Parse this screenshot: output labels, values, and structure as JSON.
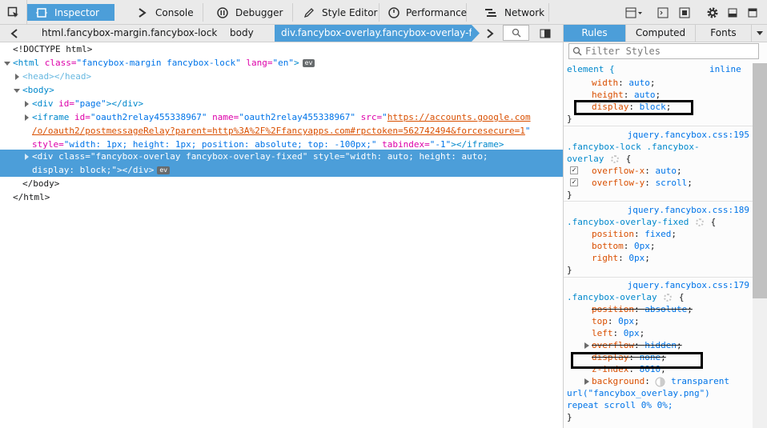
{
  "toolbar": {
    "tabs": [
      {
        "label": "Inspector",
        "icon": "inspector-icon"
      },
      {
        "label": "Console",
        "icon": "console-icon"
      },
      {
        "label": "Debugger",
        "icon": "debugger-icon"
      },
      {
        "label": "Style Editor",
        "icon": "style-editor-icon"
      },
      {
        "label": "Performance",
        "icon": "performance-icon"
      },
      {
        "label": "Network",
        "icon": "network-icon"
      }
    ]
  },
  "breadcrumb": [
    "html.fancybox-margin.fancybox-lock",
    "body",
    "div.fancybox-overlay.fancybox-overlay-fi..."
  ],
  "markup": {
    "doctype": "<!DOCTYPE html>",
    "html_open": {
      "tag": "<html",
      "a1": " class=",
      "v1": "\"fancybox-margin fancybox-lock\"",
      "a2": " lang=",
      "v2": "\"en\"",
      "end": ">"
    },
    "ev": "ev",
    "head": "<head></head>",
    "body_open": "<body>",
    "div_page": {
      "tag": "<div",
      "a1": " id=",
      "v1": "\"page\"",
      "end": "></div>"
    },
    "iframe": {
      "tag": "<iframe",
      "a1": " id=",
      "v1": "\"oauth2relay455338967\"",
      "a2": " name=",
      "v2": "\"oauth2relay455338967\"",
      "a3": " src=",
      "q": "\"",
      "link1": "https://accounts.google.com",
      "link2": "/o/oauth2/postmessageRelay?parent=http%3A%2F%2Ffancyapps.com#rpctoken=562742494&forcesecure=1",
      "a4": "style=",
      "v4": "\"width: 1px; height: 1px; position: absolute; top: -100px;\"",
      "a5": " tabindex=",
      "v5": "\"-1\"",
      "end": "></iframe>"
    },
    "sel_div": {
      "tag": "<div",
      "a1": " class=",
      "v1": "\"fancybox-overlay fancybox-overlay-fixed\"",
      "a2": " style=",
      "v2a": "\"width: auto; height: auto;",
      "v2b": "display: block;\"",
      "end": "></div>"
    },
    "body_close": "</body>",
    "html_close": "</html>"
  },
  "sidebar": {
    "tabs": [
      "Rules",
      "Computed",
      "Fonts"
    ],
    "filter_placeholder": "Filter Styles",
    "rules": [
      {
        "selector": "element {",
        "source": "inline",
        "decls": [
          {
            "name": "width",
            "value": "auto",
            "struck": false
          },
          {
            "name": "height",
            "value": "auto",
            "struck": false
          },
          {
            "name": "display",
            "value": "block",
            "struck": false
          }
        ]
      },
      {
        "source": "jquery.fancybox.css:195",
        "sel1": ".fancybox-lock .fancybox-",
        "sel2": "overlay",
        "decls": [
          {
            "name": "overflow-x",
            "value": "auto",
            "struck": false,
            "checked": true
          },
          {
            "name": "overflow-y",
            "value": "scroll",
            "struck": false,
            "checked": true
          }
        ]
      },
      {
        "source": "jquery.fancybox.css:189",
        "sel1": ".fancybox-overlay-fixed",
        "decls": [
          {
            "name": "position",
            "value": "fixed",
            "struck": false
          },
          {
            "name": "bottom",
            "value": "0px",
            "struck": false
          },
          {
            "name": "right",
            "value": "0px",
            "struck": false
          }
        ]
      },
      {
        "source": "jquery.fancybox.css:179",
        "sel1": ".fancybox-overlay",
        "decls": [
          {
            "name": "position",
            "value": "absolute",
            "struck": true
          },
          {
            "name": "top",
            "value": "0px",
            "struck": false
          },
          {
            "name": "left",
            "value": "0px",
            "struck": false
          },
          {
            "name": "overflow",
            "value": "hidden",
            "struck": true
          },
          {
            "name": "display",
            "value": "none",
            "struck": true
          },
          {
            "name": "z-index",
            "value": "8010",
            "struck": false
          },
          {
            "name": "background",
            "value": "transparent",
            "struck": false
          }
        ],
        "bg_cont1": "url(\"fancybox_overlay.png\")",
        "bg_cont2": "repeat scroll 0% 0%;"
      }
    ],
    "brace_open": "{",
    "brace_close": "}"
  }
}
